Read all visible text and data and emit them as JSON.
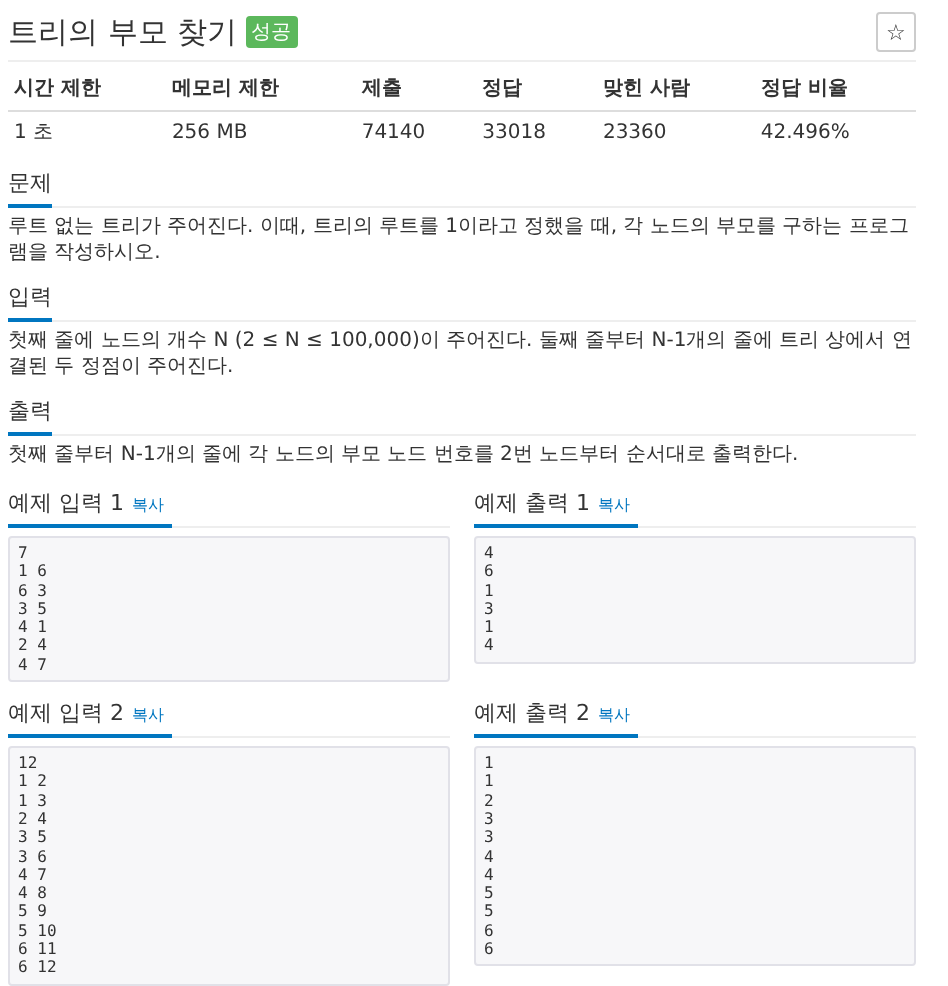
{
  "title": "트리의 부모 찾기",
  "badge": "성공",
  "star_button": "☆",
  "table": {
    "columns": [
      "시간 제한",
      "메모리 제한",
      "제출",
      "정답",
      "맞힌 사람",
      "정답 비율"
    ],
    "rows": [
      [
        "1 초",
        "256 MB",
        "74140",
        "33018",
        "23360",
        "42.496%"
      ]
    ]
  },
  "sections": [
    {
      "heading": "문제",
      "text": "루트 없는 트리가 주어진다. 이때, 트리의 루트를 1이라고 정했을 때, 각 노드의 부모를 구하는 프로그램을 작성하시오."
    },
    {
      "heading": "입력",
      "text": "첫째 줄에 노드의 개수 N (2 ≤ N ≤ 100,000)이 주어진다. 둘째 줄부터 N-1개의 줄에 트리 상에서 연결된 두 정점이 주어진다."
    },
    {
      "heading": "출력",
      "text": "첫째 줄부터 N-1개의 줄에 각 노드의 부모 노드 번호를 2번 노드부터 순서대로 출력한다."
    }
  ],
  "samples": [
    {
      "heading": "예제 입력 1",
      "copy": "복사",
      "lines": [
        "7",
        "1 6",
        "6 3",
        "3 5",
        "4 1",
        "2 4",
        "4 7"
      ]
    },
    {
      "heading": "예제 출력 1",
      "copy": "복사",
      "lines": [
        "4",
        "6",
        "1",
        "3",
        "1",
        "4"
      ]
    },
    {
      "heading": "예제 입력 2",
      "copy": "복사",
      "lines": [
        "12",
        "1 2",
        "1 3",
        "2 4",
        "3 5",
        "3 6",
        "4 7",
        "4 8",
        "5 9",
        "5 10",
        "6 11",
        "6 12"
      ]
    },
    {
      "heading": "예제 출력 2",
      "copy": "복사",
      "lines": [
        "1",
        "1",
        "2",
        "3",
        "3",
        "4",
        "4",
        "5",
        "5",
        "6",
        "6"
      ]
    }
  ]
}
